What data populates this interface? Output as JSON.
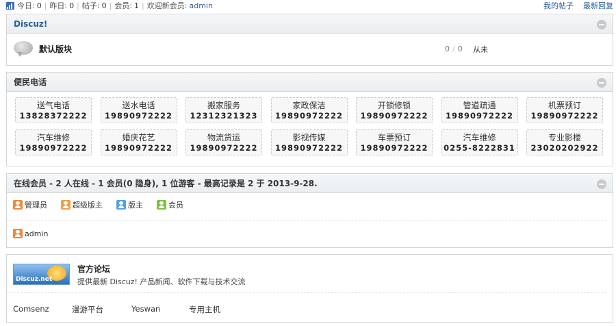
{
  "topbar": {
    "today_label": "今日:",
    "today_value": "0",
    "yesterday_label": "昨日:",
    "yesterday_value": "0",
    "posts_label": "帖子:",
    "posts_value": "0",
    "members_label": "会员:",
    "members_value": "1",
    "welcome_label": "欢迎新会员:",
    "welcome_user": "admin",
    "my_posts": "我的帖子",
    "latest_reply": "最新回复"
  },
  "category": {
    "title": "Discuz!",
    "forum": {
      "name": "默认版块",
      "threads": "0",
      "posts": "0",
      "last": "从未"
    }
  },
  "phones": {
    "title": "便民电话",
    "items": [
      {
        "name": "送气电话",
        "tel": "13828372222"
      },
      {
        "name": "送水电话",
        "tel": "19890972222"
      },
      {
        "name": "搬家服务",
        "tel": "12312321323"
      },
      {
        "name": "家政保洁",
        "tel": "19890972222"
      },
      {
        "name": "开锁修锁",
        "tel": "19890972222"
      },
      {
        "name": "管道疏通",
        "tel": "19890972222"
      },
      {
        "name": "机票预订",
        "tel": "19890972222"
      },
      {
        "name": "汽车维修",
        "tel": "19890972222"
      },
      {
        "name": "婚庆花艺",
        "tel": "19890972222"
      },
      {
        "name": "物流货运",
        "tel": "19890972222"
      },
      {
        "name": "影视传媒",
        "tel": "19890972222"
      },
      {
        "name": "车票预订",
        "tel": "19890972222"
      },
      {
        "name": "汽车维修",
        "tel": "0255-8222831"
      },
      {
        "name": "专业影楼",
        "tel": "23020202922"
      }
    ]
  },
  "online": {
    "title": "在线会员 - 2 人在线 - 1 会员(0 隐身), 1 位游客 - 最高记录是 2 于 2013-9-28.",
    "legend": [
      {
        "label": "管理员",
        "color": "#f08a3c"
      },
      {
        "label": "超级版主",
        "color": "#f0a040"
      },
      {
        "label": "版主",
        "color": "#4fa3e0"
      },
      {
        "label": "会员",
        "color": "#7dc242"
      }
    ],
    "users": [
      {
        "name": "admin",
        "color": "#f08a3c"
      }
    ]
  },
  "links": {
    "logo_text": "Discuz.net",
    "title": "官方论坛",
    "desc": "提供最新 Discuz! 产品新闻、软件下载与技术交流",
    "items": [
      "Comsenz",
      "漫游平台",
      "Yeswan",
      "专用主机"
    ]
  }
}
